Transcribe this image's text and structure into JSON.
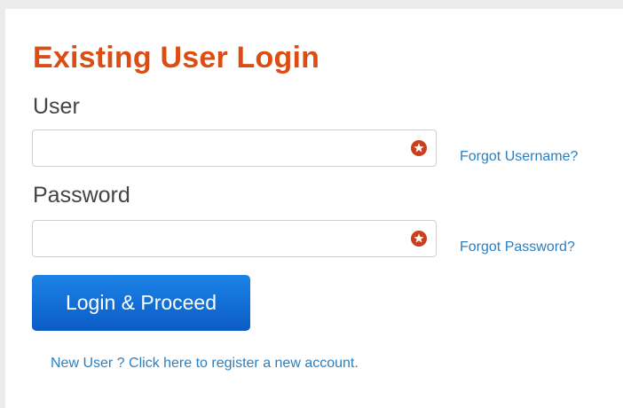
{
  "login": {
    "title": "Existing User Login",
    "user_label": "User",
    "user_value": "",
    "user_required_icon": "required-star-icon",
    "forgot_username": "Forgot Username?",
    "password_label": "Password",
    "password_value": "",
    "password_required_icon": "required-star-icon",
    "forgot_password": "Forgot Password?",
    "submit_label": "Login & Proceed",
    "register_link": "New User ? Click here to register a new account."
  },
  "colors": {
    "title": "#dc4d13",
    "link": "#2a7fc1",
    "button_top": "#1c83e6",
    "button_bottom": "#0b5cc5",
    "required_icon": "#c8401d"
  }
}
